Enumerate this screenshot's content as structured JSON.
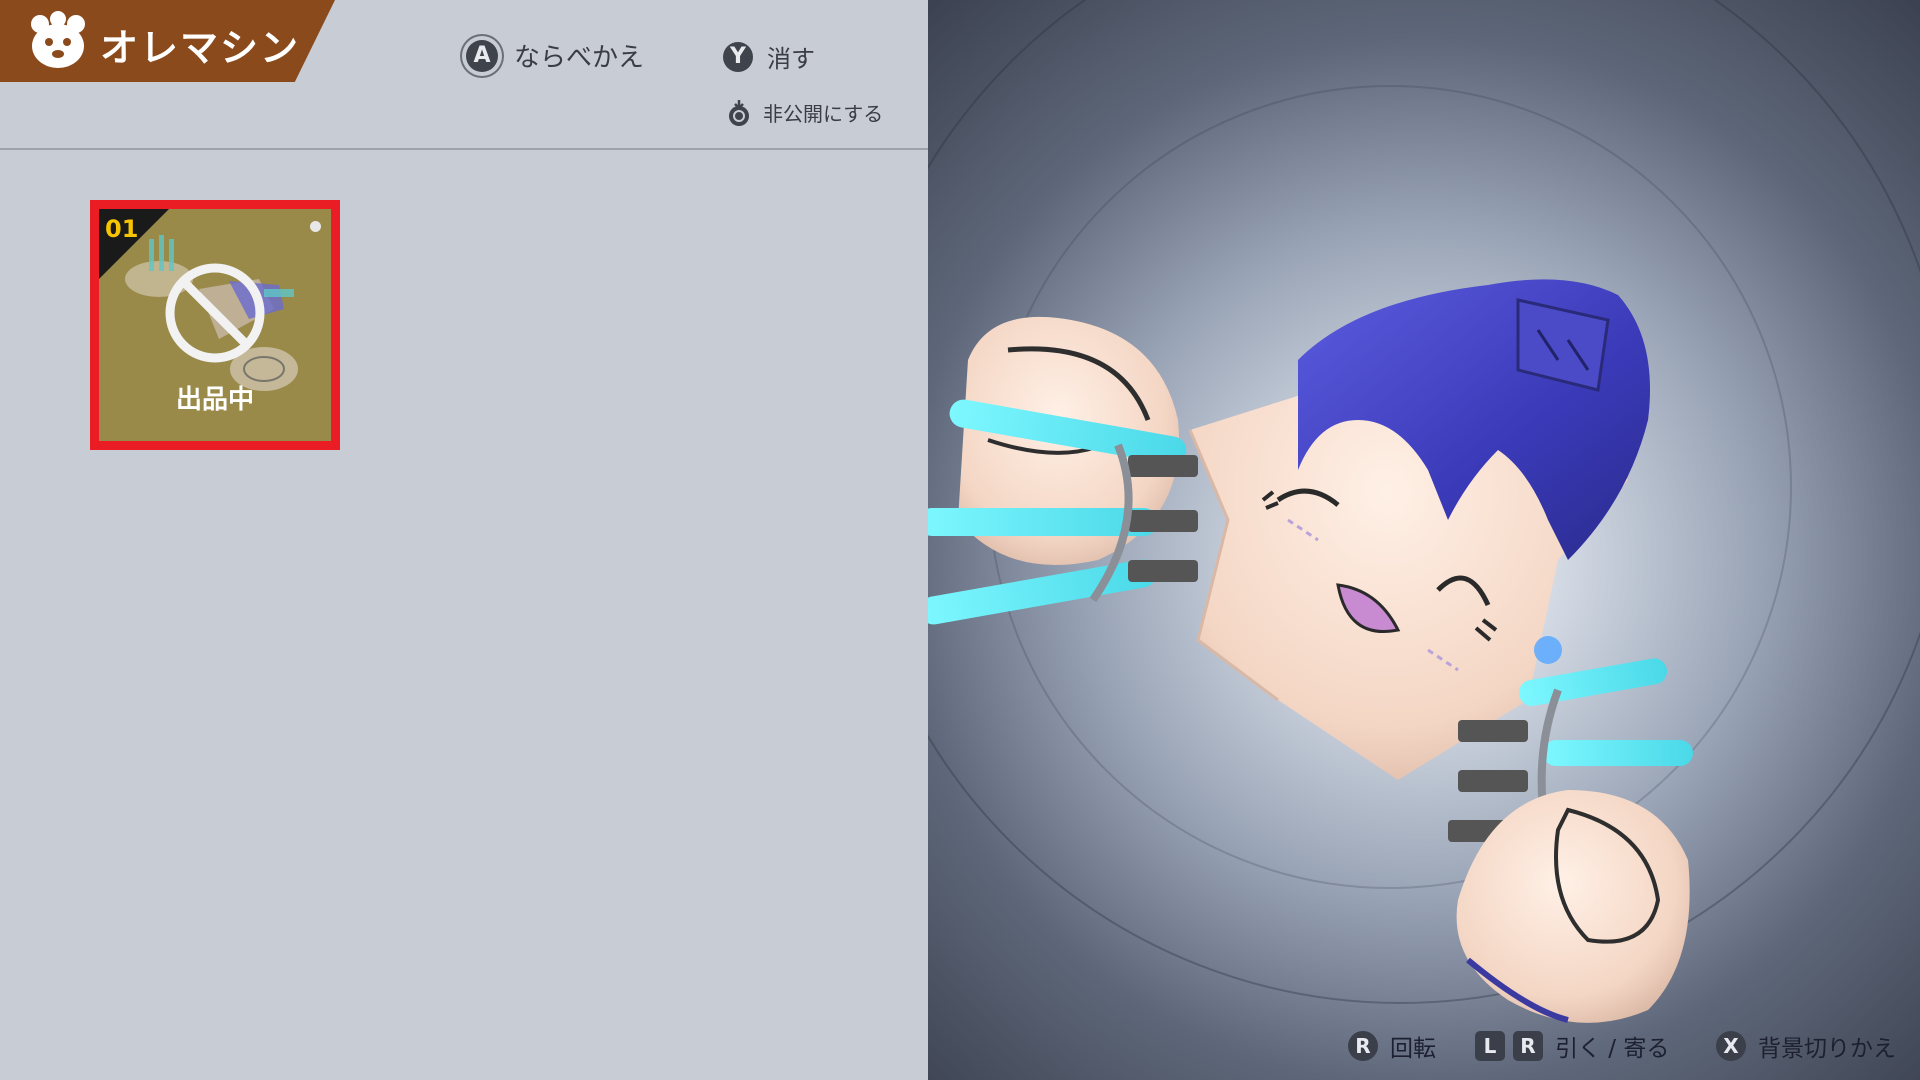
{
  "header": {
    "title": "オレマシン",
    "title_icon": "mascot-face-icon",
    "brand_color": "#8a4a1c"
  },
  "hints": {
    "sort": {
      "button": "A",
      "label": "ならべかえ"
    },
    "delete": {
      "button": "Y",
      "label": "消す"
    },
    "private": {
      "icon": "stick-press-icon",
      "label": "非公開にする"
    }
  },
  "items": [
    {
      "number": "01",
      "status": "出品中",
      "selected": true,
      "status_icon": "no-entry-icon"
    }
  ],
  "viewer_controls": {
    "rotate": {
      "button": "R",
      "label": "回転"
    },
    "zoom": {
      "buttons": [
        "L",
        "R"
      ],
      "label": "引く / 寄る"
    },
    "background": {
      "button": "X",
      "label": "背景切りかえ"
    }
  },
  "colors": {
    "selection_border": "#ea1c24",
    "number_color": "#f7c400",
    "glow": "#6ff4ff"
  }
}
